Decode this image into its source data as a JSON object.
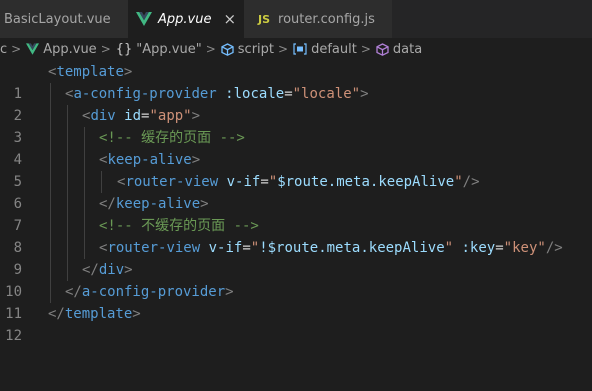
{
  "tabs": [
    {
      "label": "BasicLayout.vue",
      "active": false
    },
    {
      "label": "App.vue",
      "active": true,
      "close": "×"
    },
    {
      "label": "router.config.js",
      "active": false,
      "icon_text": "JS"
    }
  ],
  "breadcrumb": {
    "root": "c",
    "file": "App.vue",
    "object": "\"App.vue\"",
    "object_icon": "{}",
    "script": "script",
    "default": "default",
    "data": "data"
  },
  "code": {
    "line_numbers": [
      "1",
      "2",
      "3",
      "4",
      "5",
      "6",
      "7",
      "8",
      "9",
      "10",
      "11",
      "12"
    ],
    "l1": {
      "open": "<",
      "name": "template",
      "close": ">"
    },
    "l2": {
      "open": "<",
      "name": "a-config-provider",
      "attr": ":locale",
      "eq": "=",
      "val": "\"locale\"",
      "close": ">"
    },
    "l3": {
      "open": "<",
      "name": "div",
      "attr": "id",
      "eq": "=",
      "val": "\"app\"",
      "close": ">"
    },
    "l4": {
      "comment": "<!-- 缓存的页面 -->"
    },
    "l5": {
      "open": "<",
      "name": "keep-alive",
      "close": ">"
    },
    "l6": {
      "open": "<",
      "name": "router-view",
      "attr": "v-if",
      "eq": "=",
      "q1": "\"",
      "expr": "$route.meta.keepAlive",
      "q2": "\"",
      "close": "/>"
    },
    "l7": {
      "open": "</",
      "name": "keep-alive",
      "close": ">"
    },
    "l8": {
      "comment": "<!-- 不缓存的页面 -->"
    },
    "l9": {
      "open": "<",
      "name": "router-view",
      "attr": "v-if",
      "eq": "=",
      "q1": "\"",
      "expr": "!$route.meta.keepAlive",
      "q2": "\"",
      "attr2": ":key",
      "eq2": "=",
      "val2": "\"key\"",
      "close": "/>"
    },
    "l10": {
      "open": "</",
      "name": "div",
      "close": ">"
    },
    "l11": {
      "open": "</",
      "name": "a-config-provider",
      "close": ">"
    },
    "l12": {
      "open": "</",
      "name": "template",
      "close": ">"
    }
  },
  "colors": {
    "tag": "#569cd6",
    "attribute": "#9cdcfe",
    "string": "#ce9178",
    "comment": "#6a9955",
    "background": "#1e1e1e"
  }
}
